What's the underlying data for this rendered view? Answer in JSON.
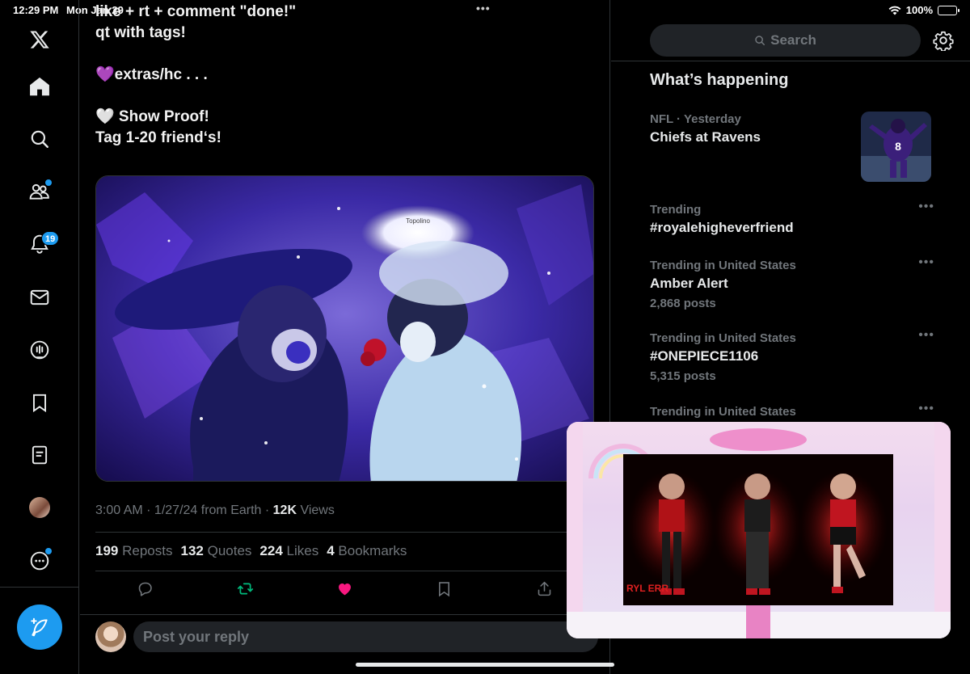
{
  "status_bar": {
    "time": "12:29 PM",
    "date": "Mon Jan 29",
    "battery": "100%"
  },
  "tweet": {
    "text_lines": [
      "like + rt + comment \"done!\"",
      "qt with tags!",
      "",
      "💜extras/hc . . .",
      "",
      "🤍 Show Proof!",
      "Tag 1-20 friend‘s!"
    ],
    "media_watermark": "Topolino",
    "meta_time": "3:00 AM · 1/27/24 from Earth · ",
    "views_count": "12K",
    "views_label": " Views",
    "stats": {
      "reposts_count": "199",
      "reposts_label": "Reposts",
      "quotes_count": "132",
      "quotes_label": "Quotes",
      "likes_count": "224",
      "likes_label": "Likes",
      "bookmarks_count": "4",
      "bookmarks_label": "Bookmarks"
    }
  },
  "nav": {
    "notifications_badge": "19"
  },
  "reply": {
    "placeholder": "Post your reply"
  },
  "sidebar": {
    "search_placeholder": "Search",
    "section_title": "What’s happening",
    "trends": [
      {
        "context": "NFL · Yesterday",
        "name": "Chiefs at Ravens"
      },
      {
        "context": "Trending",
        "name": "#royalehigheverfriend"
      },
      {
        "context": "Trending in United States",
        "name": "Amber Alert",
        "posts": "2,868 posts"
      },
      {
        "context": "Trending in United States",
        "name": "#ONEPIECE1106",
        "posts": "5,315 posts"
      },
      {
        "context": "Trending in United States"
      }
    ]
  },
  "pip": {
    "watermark": "RYL ERR"
  },
  "colors": {
    "accent": "#1d9bf0",
    "like": "#f91880",
    "repost": "#00ba7c",
    "background": "#000000",
    "border": "#2f3336",
    "muted": "#71767b"
  }
}
